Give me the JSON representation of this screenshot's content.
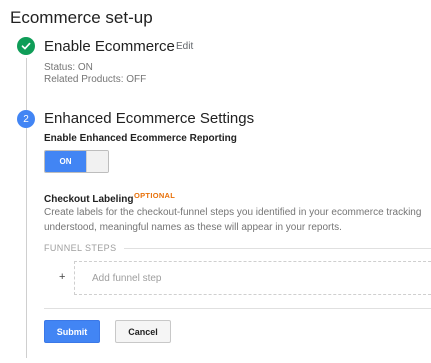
{
  "page": {
    "title": "Ecommerce set-up"
  },
  "step1": {
    "title": "Enable Ecommerce",
    "edit_label": "Edit",
    "status": "Status: ON",
    "related": "Related Products: OFF",
    "icon": "checkmark-icon",
    "color": "#0f9d58"
  },
  "step2": {
    "number": "2",
    "title": "Enhanced Ecommerce Settings",
    "color": "#4285f4",
    "reporting_label": "Enable Enhanced Ecommerce Reporting",
    "toggle": {
      "state": "ON"
    },
    "checkout": {
      "label": "Checkout Labeling",
      "optional": "OPTIONAL",
      "desc_line1": "Create labels for the checkout-funnel steps you identified in your ecommerce tracking",
      "desc_line2": "understood, meaningful names as these will appear in your reports."
    },
    "funnel": {
      "header": "FUNNEL STEPS",
      "add_icon": "+",
      "add_placeholder": "Add funnel step"
    }
  },
  "actions": {
    "submit": "Submit",
    "cancel": "Cancel"
  }
}
